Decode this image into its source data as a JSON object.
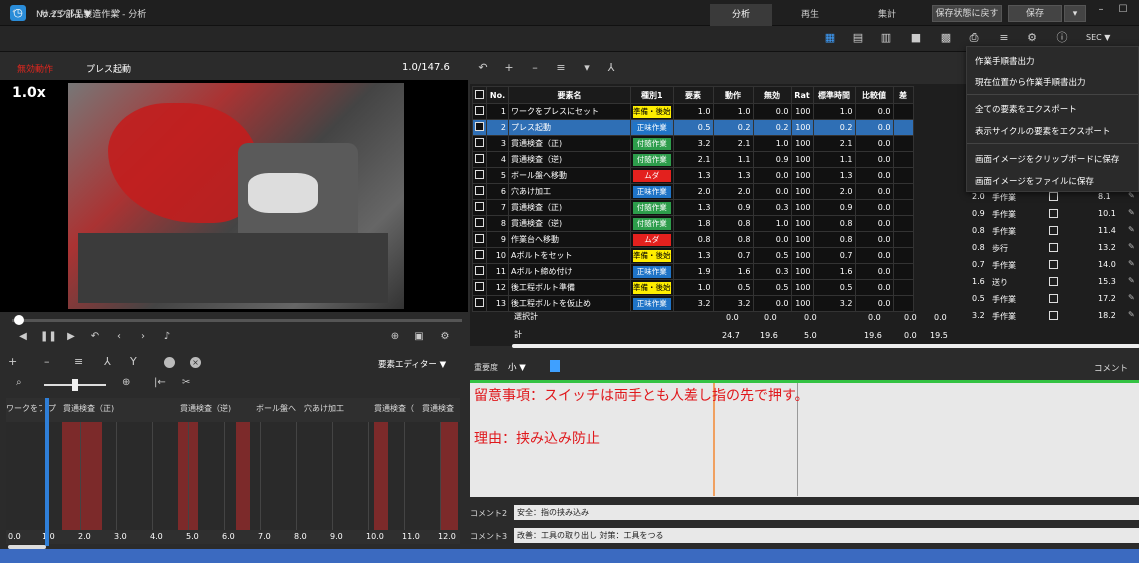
{
  "app": {
    "title": "No.25 部品製造作業 - 分析",
    "icon": "stopwatch-icon"
  },
  "main_tabs": [
    {
      "label": "分析"
    },
    {
      "label": "再生"
    },
    {
      "label": "集計"
    }
  ],
  "title_buttons": {
    "revert": "保存状態に戻す",
    "save": "保存"
  },
  "navbar": {
    "cycle": "サイクル1 ▼",
    "sec": "SEC ▼"
  },
  "video": {
    "action_label": "無効動作",
    "press_label": "プレス起動",
    "time": "1.0/147.6",
    "speed": "1.0x"
  },
  "table": {
    "headers": [
      "No.",
      "要素名",
      "種別1",
      "要素",
      "動作",
      "無効",
      "Rat",
      "標準時間",
      "比較値",
      "差"
    ],
    "rows": [
      {
        "no": "1",
        "name": "ワークをプレスにセット",
        "kind": "準備・後始",
        "kclass": "k-prep",
        "e": "1.0",
        "d": "1.0",
        "m": "0.0",
        "r": "100",
        "s": "1.0",
        "c": "0.0"
      },
      {
        "no": "2",
        "name": "プレス起動",
        "kind": "正味作業",
        "kclass": "k-main",
        "e": "0.5",
        "d": "0.2",
        "m": "0.2",
        "r": "100",
        "s": "0.2",
        "c": "0.0"
      },
      {
        "no": "3",
        "name": "貫通検査（正)",
        "kind": "付随作業",
        "kclass": "k-aux",
        "e": "3.2",
        "d": "2.1",
        "m": "1.0",
        "r": "100",
        "s": "2.1",
        "c": "0.0"
      },
      {
        "no": "4",
        "name": "貫通検査（逆)",
        "kind": "付随作業",
        "kclass": "k-aux",
        "e": "2.1",
        "d": "1.1",
        "m": "0.9",
        "r": "100",
        "s": "1.1",
        "c": "0.0"
      },
      {
        "no": "5",
        "name": "ボール盤へ移動",
        "kind": "ムダ",
        "kclass": "k-muda",
        "e": "1.3",
        "d": "1.3",
        "m": "0.0",
        "r": "100",
        "s": "1.3",
        "c": "0.0"
      },
      {
        "no": "6",
        "name": "穴あけ加工",
        "kind": "正味作業",
        "kclass": "k-main",
        "e": "2.0",
        "d": "2.0",
        "m": "0.0",
        "r": "100",
        "s": "2.0",
        "c": "0.0",
        "x": "2.0",
        "y": "手作業",
        "z": "8.1"
      },
      {
        "no": "7",
        "name": "貫通検査（正)",
        "kind": "付随作業",
        "kclass": "k-aux",
        "e": "1.3",
        "d": "0.9",
        "m": "0.3",
        "r": "100",
        "s": "0.9",
        "c": "0.0",
        "x": "0.9",
        "y": "手作業",
        "z": "10.1"
      },
      {
        "no": "8",
        "name": "貫通検査（逆)",
        "kind": "付随作業",
        "kclass": "k-aux",
        "e": "1.8",
        "d": "0.8",
        "m": "1.0",
        "r": "100",
        "s": "0.8",
        "c": "0.0",
        "x": "0.8",
        "y": "手作業",
        "z": "11.4"
      },
      {
        "no": "9",
        "name": "作業台へ移動",
        "kind": "ムダ",
        "kclass": "k-muda",
        "e": "0.8",
        "d": "0.8",
        "m": "0.0",
        "r": "100",
        "s": "0.8",
        "c": "0.0",
        "x": "0.8",
        "y": "歩行",
        "z": "13.2"
      },
      {
        "no": "10",
        "name": "Aボルトをセット",
        "kind": "準備・後始",
        "kclass": "k-prep",
        "e": "1.3",
        "d": "0.7",
        "m": "0.5",
        "r": "100",
        "s": "0.7",
        "c": "0.0",
        "x": "0.7",
        "y": "手作業",
        "z": "14.0"
      },
      {
        "no": "11",
        "name": "Aボルト締め付け",
        "kind": "正味作業",
        "kclass": "k-main",
        "e": "1.9",
        "d": "1.6",
        "m": "0.3",
        "r": "100",
        "s": "1.6",
        "c": "0.0",
        "x": "1.6",
        "y": "送り",
        "z": "15.3"
      },
      {
        "no": "12",
        "name": "後工程ボルト準備",
        "kind": "準備・後始",
        "kclass": "k-prep",
        "e": "1.0",
        "d": "0.5",
        "m": "0.5",
        "r": "100",
        "s": "0.5",
        "c": "0.0",
        "x": "0.5",
        "y": "手作業",
        "z": "17.2"
      },
      {
        "no": "13",
        "name": "後工程ボルトを仮止め",
        "kind": "正味作業",
        "kclass": "k-main",
        "e": "3.2",
        "d": "3.2",
        "m": "0.0",
        "r": "100",
        "s": "3.2",
        "c": "0.0",
        "x": "3.2",
        "y": "手作業",
        "z": "18.2"
      }
    ],
    "totals": {
      "sel_label": "選択計",
      "sum_label": "計",
      "sel": [
        "0.0",
        "0.0",
        "0.0",
        "0.0",
        "0.0",
        "0.0"
      ],
      "sum": [
        "24.7",
        "19.6",
        "5.0",
        "19.6",
        "0.0",
        "19.5"
      ]
    }
  },
  "menu": {
    "items": [
      "作業手順書出力",
      "現在位置から作業手順書出力",
      "全ての要素をエクスポート",
      "表示サイクルの要素をエクスポート",
      "画面イメージをクリップボードに保存",
      "画面イメージをファイルに保存"
    ]
  },
  "timeline": {
    "editor_label": "要素エディター ▼",
    "headers": [
      "ワークをプレス",
      "プ",
      "貫通検査（正)",
      "貫通検査（逆)",
      "ボール盤へ",
      "穴あけ加工",
      "貫通検査（",
      "貫通検査"
    ],
    "ticks": [
      "0.0",
      "1.0",
      "2.0",
      "3.0",
      "4.0",
      "5.0",
      "6.0",
      "7.0",
      "8.0",
      "9.0",
      "10.0",
      "11.0",
      "12.0"
    ]
  },
  "comment": {
    "importance_label": "重要度",
    "importance_value": "小 ▼",
    "title": "コメント",
    "main_line1": "留意事項：スイッチは両手とも人差し指の先で押す。",
    "main_line2": "理由：挟み込み防止",
    "c2_label": "コメント2",
    "c2_value": "安全：指の挟み込み",
    "c3_label": "コメント3",
    "c3_value": "改善：工具の取り出し 対策：工具をつる"
  }
}
